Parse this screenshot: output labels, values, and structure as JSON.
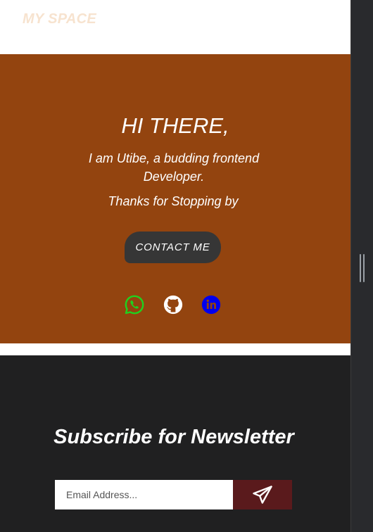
{
  "navbar": {
    "logo": "MY SPACE"
  },
  "hero": {
    "title": "HI THERE,",
    "intro": "I am Utibe, a budding frontend Developer.",
    "thanks": "Thanks for Stopping by",
    "contact_label": "CONTACT ME",
    "socials": [
      {
        "name": "whatsapp",
        "icon": "whatsapp-icon",
        "color": "#1fd11f"
      },
      {
        "name": "github",
        "icon": "github-icon",
        "color": "#ffffff"
      },
      {
        "name": "linkedin",
        "icon": "linkedin-icon",
        "color": "#0000ee"
      }
    ]
  },
  "newsletter": {
    "title": "Subscribe for Newsletter",
    "email_placeholder": "Email Address...",
    "send_icon": "paper-plane-icon"
  },
  "colors": {
    "logo": "#f7e3cf",
    "hero_bg": "#93440f",
    "button_bg": "#363636",
    "newsletter_bg": "#202021",
    "send_bg": "#5a1a1c"
  }
}
